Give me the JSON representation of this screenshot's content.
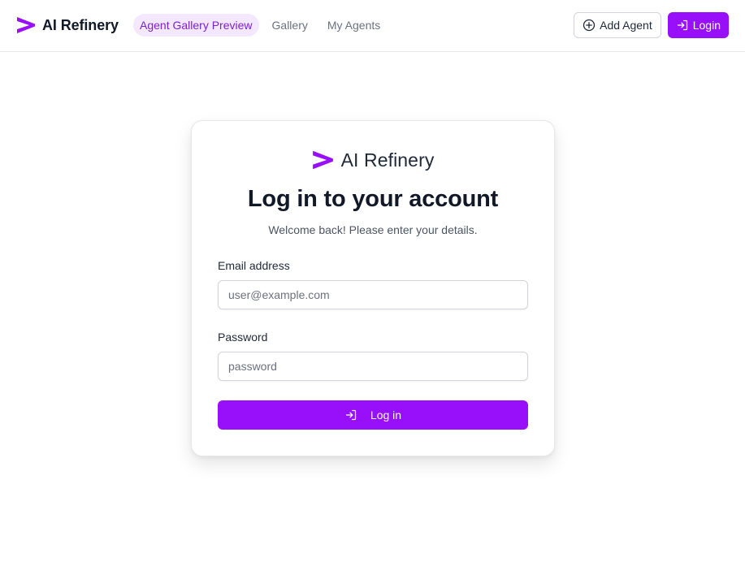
{
  "header": {
    "brand_name": "AI Refinery",
    "logo_icon": "chevron-logo-icon",
    "nav": [
      {
        "label": "Agent Gallery Preview",
        "active": true
      },
      {
        "label": "Gallery",
        "active": false
      },
      {
        "label": "My Agents",
        "active": false
      }
    ],
    "add_agent_label": "Add Agent",
    "add_agent_icon": "plus-circle-icon",
    "login_label": "Login",
    "login_icon": "login-icon"
  },
  "card": {
    "brand_name": "AI Refinery",
    "title": "Log in to your account",
    "subtitle": "Welcome back! Please enter your details.",
    "email": {
      "label": "Email address",
      "value": "",
      "placeholder": "user@example.com"
    },
    "password": {
      "label": "Password",
      "value": "",
      "placeholder": "password"
    },
    "submit_label": "Log in",
    "submit_icon": "login-icon"
  },
  "colors": {
    "accent": "#9810fa",
    "active_nav_bg": "#f3e8ff",
    "active_nav_text": "#7e22ce",
    "text_primary": "#111827",
    "border": "#d1d5db"
  }
}
